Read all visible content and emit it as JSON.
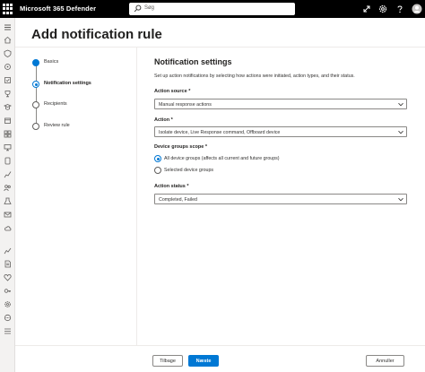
{
  "header": {
    "app_title": "Microsoft 365 Defender",
    "search_placeholder": "Søg",
    "icons": [
      "waffle-icon",
      "search-icon",
      "connect-icon",
      "settings-icon",
      "help-icon",
      "avatar-icon"
    ]
  },
  "rail": {
    "icons": [
      "menu-icon",
      "home-icon",
      "incidents-icon",
      "hunting-icon",
      "actions-icon",
      "secure-score-icon",
      "learning-icon",
      "trials-icon",
      "assets-icon",
      "devices-icon",
      "endpoints-icon",
      "vulnerability-icon",
      "partners-icon",
      "evaluation-icon",
      "email-icon",
      "cloud-apps-icon",
      "reports-icon",
      "audit-icon",
      "health-icon",
      "permissions-icon",
      "settings-icon",
      "more-icon"
    ]
  },
  "page": {
    "title": "Add notification rule"
  },
  "steps": [
    {
      "label": "Basics",
      "state": "done"
    },
    {
      "label": "Notification settings",
      "state": "current"
    },
    {
      "label": "Recipients",
      "state": "upcoming"
    },
    {
      "label": "Review rule",
      "state": "upcoming"
    }
  ],
  "form": {
    "title": "Notification settings",
    "description": "Set up action notifications by selecting how actions were initiated, action types, and their status.",
    "action_source": {
      "label": "Action source *",
      "value": "Manual response actions"
    },
    "action": {
      "label": "Action *",
      "value": "Isolate device, Live Response command, Offboard device"
    },
    "device_groups": {
      "label": "Device groups scope *",
      "options": [
        {
          "label": "All device groups (affects all current and future groups)",
          "selected": true
        },
        {
          "label": "Selected device groups",
          "selected": false
        }
      ]
    },
    "action_status": {
      "label": "Action status *",
      "value": "Completed, Failed"
    }
  },
  "footer": {
    "back_label": "Tilbage",
    "next_label": "Næste",
    "cancel_label": "Annuller"
  },
  "colors": {
    "accent": "#0078d4",
    "topbar": "#000000",
    "rail": "#f3f2f1"
  }
}
